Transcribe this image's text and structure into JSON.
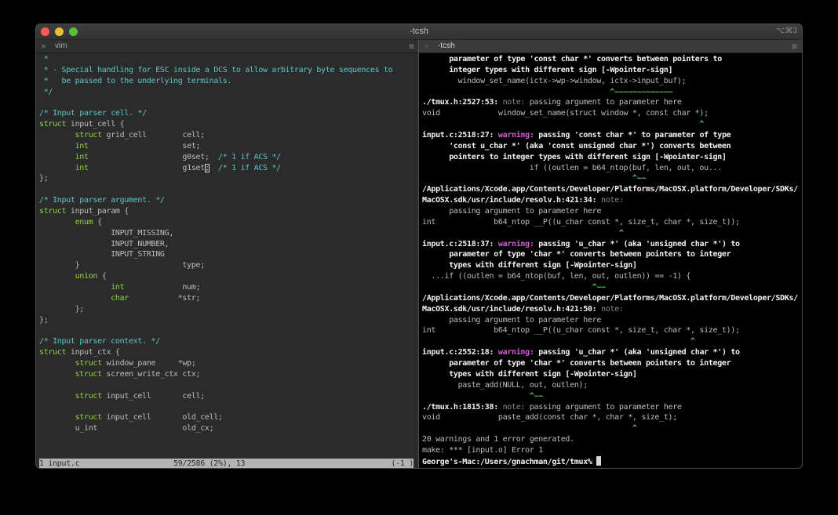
{
  "window": {
    "title": "-tcsh",
    "shortcut": "⌥⌘3",
    "traffic_lights": {
      "close": "#fc5b57",
      "minimize": "#e5bf3c",
      "zoom": "#57c038"
    }
  },
  "left_tab": {
    "label": "vim",
    "close_icon": "close-icon",
    "menu_icon": "hamburger-icon"
  },
  "right_tab": {
    "label": "-tcsh",
    "close_icon": "close-icon",
    "menu_icon": "hamburger-icon"
  },
  "left": {
    "lines": [
      [
        {
          "t": " *",
          "c": "comment"
        }
      ],
      [
        {
          "t": " * - Special handling for ESC inside a DCS to allow arbitrary byte sequences to",
          "c": "comment"
        }
      ],
      [
        {
          "t": " *   be passed to the underlying terminals.",
          "c": "comment"
        }
      ],
      [
        {
          "t": " */",
          "c": "comment"
        }
      ],
      [],
      [
        {
          "t": "/* Input parser cell. */",
          "c": "comment"
        }
      ],
      [
        {
          "t": "struct",
          "c": "keyword"
        },
        {
          "t": " input_cell {",
          "c": "text"
        }
      ],
      [
        {
          "t": "        ",
          "c": "text"
        },
        {
          "t": "struct",
          "c": "keyword"
        },
        {
          "t": " grid_cell        cell;",
          "c": "text"
        }
      ],
      [
        {
          "t": "        ",
          "c": "text"
        },
        {
          "t": "int",
          "c": "keyword"
        },
        {
          "t": "                     set;",
          "c": "text"
        }
      ],
      [
        {
          "t": "        ",
          "c": "text"
        },
        {
          "t": "int",
          "c": "keyword"
        },
        {
          "t": "                     g0set;  ",
          "c": "text"
        },
        {
          "t": "/* 1 if ACS */",
          "c": "comment"
        }
      ],
      [
        {
          "t": "        ",
          "c": "text"
        },
        {
          "t": "int",
          "c": "keyword"
        },
        {
          "t": "                     g1set",
          "c": "text"
        },
        {
          "t": ";",
          "c": "cursor"
        },
        {
          "t": "  ",
          "c": "text"
        },
        {
          "t": "/* 1 if ACS */",
          "c": "comment"
        }
      ],
      [
        {
          "t": "};",
          "c": "text"
        }
      ],
      [],
      [
        {
          "t": "/* Input parser argument. */",
          "c": "comment"
        }
      ],
      [
        {
          "t": "struct",
          "c": "keyword"
        },
        {
          "t": " input_param {",
          "c": "text"
        }
      ],
      [
        {
          "t": "        ",
          "c": "text"
        },
        {
          "t": "enum",
          "c": "keyword"
        },
        {
          "t": " {",
          "c": "text"
        }
      ],
      [
        {
          "t": "                INPUT_MISSING,",
          "c": "text"
        }
      ],
      [
        {
          "t": "                INPUT_NUMBER,",
          "c": "text"
        }
      ],
      [
        {
          "t": "                INPUT_STRING",
          "c": "text"
        }
      ],
      [
        {
          "t": "        }                       type;",
          "c": "text"
        }
      ],
      [
        {
          "t": "        ",
          "c": "text"
        },
        {
          "t": "union",
          "c": "keyword"
        },
        {
          "t": " {",
          "c": "text"
        }
      ],
      [
        {
          "t": "                ",
          "c": "text"
        },
        {
          "t": "int",
          "c": "keyword"
        },
        {
          "t": "             num;",
          "c": "text"
        }
      ],
      [
        {
          "t": "                ",
          "c": "text"
        },
        {
          "t": "char",
          "c": "keyword"
        },
        {
          "t": "           *str;",
          "c": "text"
        }
      ],
      [
        {
          "t": "        };",
          "c": "text"
        }
      ],
      [
        {
          "t": "};",
          "c": "text"
        }
      ],
      [],
      [
        {
          "t": "/* Input parser context. */",
          "c": "comment"
        }
      ],
      [
        {
          "t": "struct",
          "c": "keyword"
        },
        {
          "t": " input_ctx {",
          "c": "text"
        }
      ],
      [
        {
          "t": "        ",
          "c": "text"
        },
        {
          "t": "struct",
          "c": "keyword"
        },
        {
          "t": " window_pane     *wp;",
          "c": "text"
        }
      ],
      [
        {
          "t": "        ",
          "c": "text"
        },
        {
          "t": "struct",
          "c": "keyword"
        },
        {
          "t": " screen_write_ctx ctx;",
          "c": "text"
        }
      ],
      [],
      [
        {
          "t": "        ",
          "c": "text"
        },
        {
          "t": "struct",
          "c": "keyword"
        },
        {
          "t": " input_cell       cell;",
          "c": "text"
        }
      ],
      [],
      [
        {
          "t": "        ",
          "c": "text"
        },
        {
          "t": "struct",
          "c": "keyword"
        },
        {
          "t": " input_cell       old_cell;",
          "c": "text"
        }
      ],
      [
        {
          "t": "        u_int                   old_cx;",
          "c": "text"
        }
      ]
    ],
    "status": {
      "file": "1 input.c",
      "position": "59/2586 (2%), 13",
      "extra": "(-1 )"
    }
  },
  "right": {
    "lines": [
      [
        {
          "t": "      parameter of type 'const char *' converts between pointers to",
          "c": "bold"
        }
      ],
      [
        {
          "t": "      integer types with different sign [-Wpointer-sign]",
          "c": "bold"
        }
      ],
      [
        {
          "t": "        window_set_name(ictx->wp->window, ictx->input_buf);",
          "c": "text"
        }
      ],
      [
        {
          "t": "                                          ^~~~~~~~~~~~~~",
          "c": "caret"
        }
      ],
      [
        {
          "t": "./tmux.h:2527:53: ",
          "c": "bold"
        },
        {
          "t": "note: ",
          "c": "note"
        },
        {
          "t": "passing argument to parameter here",
          "c": "text"
        }
      ],
      [
        {
          "t": "void             window_set_name(struct window *, const char *);",
          "c": "text"
        }
      ],
      [
        {
          "t": "                                                              ^",
          "c": "caret"
        }
      ],
      [
        {
          "t": "input.c:2518:27: ",
          "c": "bold"
        },
        {
          "t": "warning: ",
          "c": "warning"
        },
        {
          "t": "passing 'const char *' to parameter of type",
          "c": "bold"
        }
      ],
      [
        {
          "t": "      'const u_char *' (aka 'const unsigned char *') converts between",
          "c": "bold"
        }
      ],
      [
        {
          "t": "      pointers to integer types with different sign [-Wpointer-sign]",
          "c": "bold"
        }
      ],
      [
        {
          "t": "                        if ((outlen = b64_ntop(buf, len, out, ou...",
          "c": "text"
        }
      ],
      [
        {
          "t": "                                               ^~~",
          "c": "caret"
        }
      ],
      [
        {
          "t": "/Applications/Xcode.app/Contents/Developer/Platforms/MacOSX.platform/Developer/SDKs/",
          "c": "bold"
        }
      ],
      [
        {
          "t": "MacOSX.sdk/usr/include/resolv.h:421:34: ",
          "c": "bold"
        },
        {
          "t": "note:",
          "c": "note"
        }
      ],
      [
        {
          "t": "      passing argument to parameter here",
          "c": "text"
        }
      ],
      [
        {
          "t": "int             b64_ntop __P((u_char const *, size_t, char *, size_t));",
          "c": "text"
        }
      ],
      [
        {
          "t": "                                            ^",
          "c": "caret"
        }
      ],
      [
        {
          "t": "input.c:2518:37: ",
          "c": "bold"
        },
        {
          "t": "warning: ",
          "c": "warning"
        },
        {
          "t": "passing 'u_char *' (aka 'unsigned char *') to",
          "c": "bold"
        }
      ],
      [
        {
          "t": "      parameter of type 'char *' converts between pointers to integer",
          "c": "bold"
        }
      ],
      [
        {
          "t": "      types with different sign [-Wpointer-sign]",
          "c": "bold"
        }
      ],
      [
        {
          "t": "  ...if ((outlen = b64_ntop(buf, len, out, outlen)) == -1) {",
          "c": "text"
        }
      ],
      [
        {
          "t": "                                      ^~~",
          "c": "caret"
        }
      ],
      [
        {
          "t": "/Applications/Xcode.app/Contents/Developer/Platforms/MacOSX.platform/Developer/SDKs/",
          "c": "bold"
        }
      ],
      [
        {
          "t": "MacOSX.sdk/usr/include/resolv.h:421:50: ",
          "c": "bold"
        },
        {
          "t": "note:",
          "c": "note"
        }
      ],
      [
        {
          "t": "      passing argument to parameter here",
          "c": "text"
        }
      ],
      [
        {
          "t": "int             b64_ntop __P((u_char const *, size_t, char *, size_t));",
          "c": "text"
        }
      ],
      [
        {
          "t": "                                                            ^",
          "c": "caret"
        }
      ],
      [
        {
          "t": "input.c:2552:18: ",
          "c": "bold"
        },
        {
          "t": "warning: ",
          "c": "warning"
        },
        {
          "t": "passing 'u_char *' (aka 'unsigned char *') to",
          "c": "bold"
        }
      ],
      [
        {
          "t": "      parameter of type 'char *' converts between pointers to integer",
          "c": "bold"
        }
      ],
      [
        {
          "t": "      types with different sign [-Wpointer-sign]",
          "c": "bold"
        }
      ],
      [
        {
          "t": "        paste_add(NULL, out, outlen);",
          "c": "text"
        }
      ],
      [
        {
          "t": "                        ^~~",
          "c": "caret"
        }
      ],
      [
        {
          "t": "./tmux.h:1815:38: ",
          "c": "bold"
        },
        {
          "t": "note: ",
          "c": "note"
        },
        {
          "t": "passing argument to parameter here",
          "c": "text"
        }
      ],
      [
        {
          "t": "void             paste_add(const char *, char *, size_t);",
          "c": "text"
        }
      ],
      [
        {
          "t": "                                               ^",
          "c": "caret"
        }
      ],
      [
        {
          "t": "20 warnings and 1 error generated.",
          "c": "text"
        }
      ],
      [
        {
          "t": "make: *** [input.o] Error 1",
          "c": "text"
        }
      ],
      [
        {
          "t": "George's-Mac:/Users/gnachman/git/tmux% ",
          "c": "bold"
        }
      ]
    ]
  }
}
